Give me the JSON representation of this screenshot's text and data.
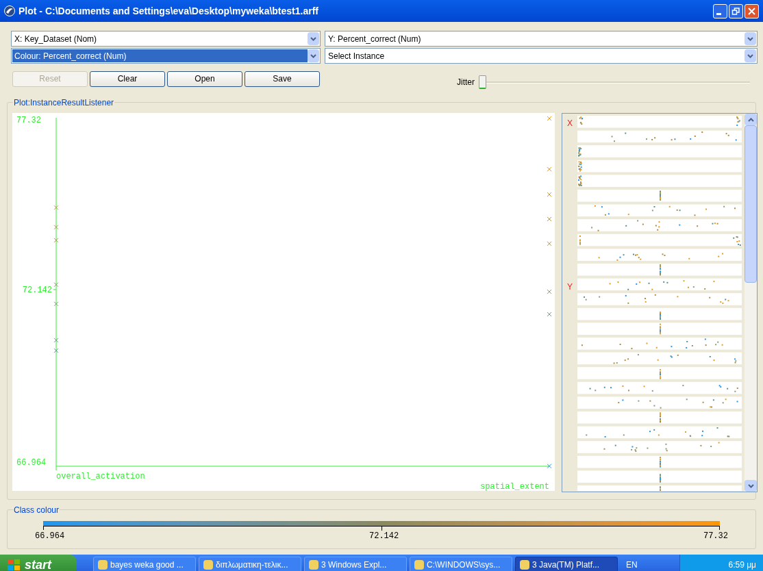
{
  "window": {
    "title": "Plot - C:\\Documents and Settings\\eva\\Desktop\\myweka\\btest1.arff"
  },
  "selectors": [
    {
      "label": "X: Key_Dataset (Nom)",
      "selected": false
    },
    {
      "label": "Y: Percent_correct (Num)",
      "selected": false
    },
    {
      "label": "Colour: Percent_correct (Num)",
      "selected": true
    },
    {
      "label": "Select Instance",
      "selected": false
    }
  ],
  "buttons": [
    {
      "label": "Reset",
      "disabled": true
    },
    {
      "label": "Clear",
      "disabled": false
    },
    {
      "label": "Open",
      "disabled": false
    },
    {
      "label": "Save",
      "disabled": false
    }
  ],
  "jitter": {
    "label": "Jitter",
    "level": 0
  },
  "plot": {
    "title": "Plot:InstanceResultListener",
    "axis": {
      "y_labels": [
        "77.32",
        "72.142",
        "66.964"
      ],
      "x_labels": [
        "overall_activation",
        "spatial_extent"
      ]
    },
    "matrix": {
      "x_label": "X",
      "y_label": "Y"
    }
  },
  "class_colour": {
    "title": "Class colour",
    "ticks": [
      "66.964",
      "72.142",
      "77.32"
    ]
  },
  "taskbar": {
    "start": "start",
    "items": [
      {
        "label": "bayes weka good ...",
        "selected": false
      },
      {
        "label": "διπλωματικη-τελικ...",
        "selected": false
      },
      {
        "label": "3 Windows Expl...",
        "selected": false
      },
      {
        "label": "C:\\WINDOWS\\sys...",
        "selected": false
      },
      {
        "label": "3 Java(TM) Platf...",
        "selected": true
      }
    ],
    "language": "EN",
    "clock": "6:59 μμ"
  }
}
